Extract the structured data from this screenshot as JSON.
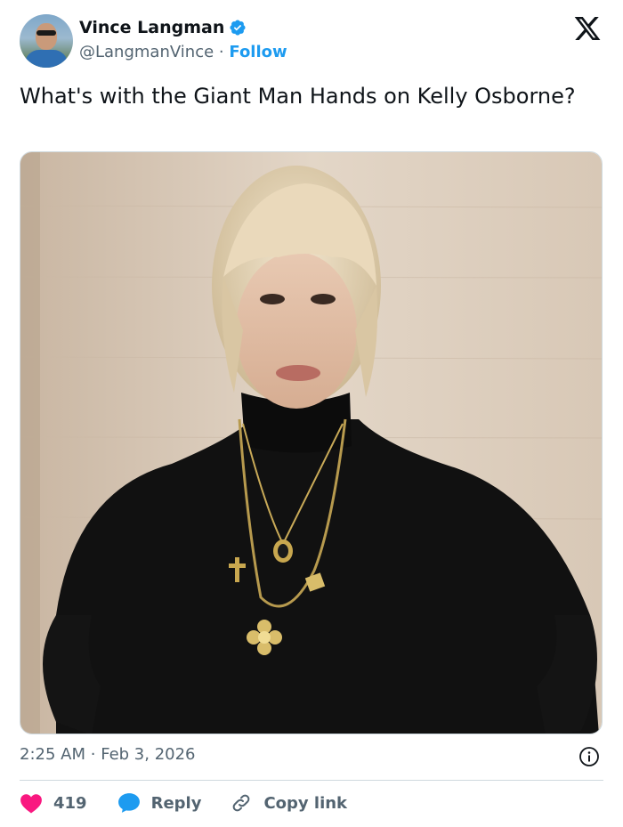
{
  "author": {
    "name": "Vince Langman",
    "handle": "@LangmanVince",
    "separator": "·",
    "follow_label": "Follow",
    "verified": true
  },
  "brand_icon": "x-logo-icon",
  "tweet": {
    "text": "What's with the Giant Man Hands on Kelly Osborne?"
  },
  "media": {
    "icon": "photo",
    "description_hidden": true
  },
  "timestamp": {
    "time": "2:25 AM",
    "separator": "·",
    "date": "Feb 3, 2026"
  },
  "actions": {
    "like_count": "419",
    "reply_label": "Reply",
    "copy_link_label": "Copy link"
  },
  "colors": {
    "accent": "#1d9bf0",
    "like": "#f91880",
    "muted": "#536471",
    "text": "#0f1419"
  }
}
